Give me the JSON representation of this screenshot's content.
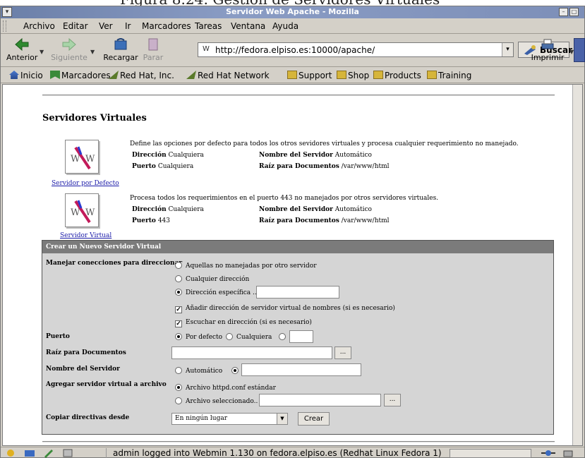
{
  "caption": "Figura 8.24: Gestión de Servidores Virtuales",
  "window": {
    "title": "Servidor Web Apache - Mozilla"
  },
  "menu": [
    "Archivo",
    "Editar",
    "Ver",
    "Ir",
    "Marcadores",
    "Tareas",
    "Ventana",
    "Ayuda"
  ],
  "nav": {
    "back": "Anterior",
    "forward": "Siguiente",
    "reload": "Recargar",
    "stop": "Parar",
    "url": "http://fedora.elpiso.es:10000/apache/",
    "search": "Buscar",
    "print": "Imprimir"
  },
  "bookmarks": [
    "Inicio",
    "Marcadores",
    "Red Hat, Inc.",
    "Red Hat Network",
    "Support",
    "Shop",
    "Products",
    "Training"
  ],
  "page": {
    "heading": "Servidores Virtuales",
    "servers": [
      {
        "icon_text": "WWW",
        "link": "Servidor por Defecto",
        "desc": "Define las opciones por defecto para todos los otros sevidores virtuales y procesa cualquier requerimiento no manejado.",
        "addr_label": "Dirección",
        "addr": "Cualquiera",
        "port_label": "Puerto",
        "port": "Cualquiera",
        "name_label": "Nombre del Servidor",
        "name": "Automático",
        "root_label": "Raíz para Documentos",
        "root": "/var/www/html"
      },
      {
        "icon_text": "WWW",
        "link": "Servidor Virtual",
        "desc": "Procesa todos los requerimientos en el puerto 443 no manejados por otros servidores virtuales.",
        "addr_label": "Dirección",
        "addr": "Cualquiera",
        "port_label": "Puerto",
        "port": "443",
        "name_label": "Nombre del Servidor",
        "name": "Automático",
        "root_label": "Raíz para Documentos",
        "root": "/var/www/html"
      }
    ],
    "form": {
      "title": "Crear un Nuevo Servidor Virtual",
      "handle_label": "Manejar conecciones para direccionar",
      "handle_opts": [
        "Aquellas no manejadas por otro servidor",
        "Cualquier dirección",
        "Dirección específica .."
      ],
      "add_name_check": "Añadir dirección de servidor virtual de nombres (si es necesario)",
      "listen_check": "Escuchar en dirección (si es necesario)",
      "port_label": "Puerto",
      "port_opts": [
        "Por defecto",
        "Cualquiera"
      ],
      "root_label": "Raíz para Documentos",
      "browse": "...",
      "server_name_label": "Nombre del Servidor",
      "server_name_auto": "Automático",
      "add_file_label": "Agregar servidor virtual a archivo",
      "file_opts": [
        "Archivo httpd.conf estándar",
        "Archivo seleccionado.."
      ],
      "copy_label": "Copiar directivas desde",
      "copy_value": "En ningún lugar",
      "create_btn": "Crear"
    }
  },
  "status": "admin logged into Webmin 1.130 on fedora.elpiso.es (Redhat Linux Fedora 1)"
}
